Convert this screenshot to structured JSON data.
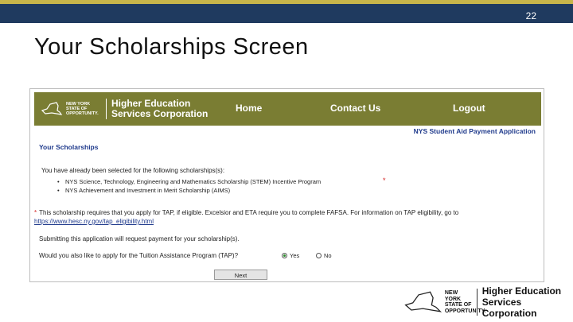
{
  "slide": {
    "number": "22",
    "title": "Your Scholarships Screen"
  },
  "colors": {
    "top_bar": "#1f3a5f",
    "accent_stripe": "#c8b54a",
    "nav_bar": "#7a7d33",
    "heading_blue": "#1f3a8c",
    "required_red": "#d32020"
  },
  "app": {
    "logo": {
      "ny_text": "NEW YORK STATE OF OPPORTUNITY.",
      "org_line1": "Higher Education",
      "org_line2": "Services Corporation"
    },
    "nav": {
      "home": "Home",
      "contact": "Contact Us",
      "logout": "Logout"
    },
    "application_title": "NYS Student Aid Payment Application",
    "section_title": "Your Scholarships",
    "intro": "You have already been selected for the following scholarships(s):",
    "scholarships": [
      "NYS Science, Technology, Engineering and Mathematics Scholarship (STEM) Incentive Program",
      "NYS Achievement and Investment in Merit Scholarship (AIMS)"
    ],
    "required_marker": "*",
    "note_text": "This scholarship requires that you apply for TAP, if eligible. Excelsior and ETA require you to complete FAFSA. For information on TAP eligibility, go to ",
    "note_link": "https://www.hesc.ny.gov/tap_eligibility.html",
    "submit_note": "Submitting this application will request payment for your scholarship(s).",
    "tap_question": "Would you also like to apply for the Tuition Assistance Program (TAP)?",
    "radio_yes": "Yes",
    "radio_no": "No",
    "selected_option": "Yes",
    "next_button": "Next"
  },
  "footer": {
    "ny_text": "NEW YORK STATE OF OPPORTUNITY.",
    "org_line1": "Higher Education",
    "org_line2": "Services Corporation"
  }
}
